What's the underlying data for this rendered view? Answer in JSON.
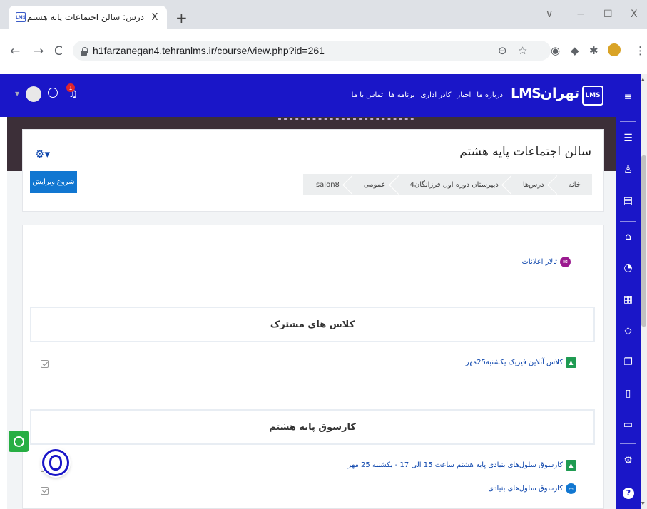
{
  "browser": {
    "tab_title": "درس: سالن اجتماعات پایه هشتم",
    "tab_favicon": "LMS",
    "tab_close": "X",
    "new_tab": "+",
    "url": "h1farzanegan4.tehranlms.ir/course/view.php?id=261",
    "window_controls": {
      "dropdown": "∨",
      "minimize": "−",
      "maximize": "☐",
      "close": "X"
    }
  },
  "navbar": {
    "logo_box": "LMS",
    "logo_text": "LMSتهران",
    "links": [
      "درباره ما",
      "اخبار",
      "کادر اداری",
      "برنامه ها",
      "تماس با ما"
    ],
    "notification_count": "1",
    "accent_color": "#1a16c8"
  },
  "header": {
    "title": "سالن اجتماعات پایه هشتم",
    "breadcrumbs": [
      "خانه",
      "درس‌ها",
      "دبیرستان دوره اول فرزانگان4",
      "عمومی",
      "salon8"
    ],
    "edit_button": "شروع ویرایش"
  },
  "content": {
    "forum_link": "تالار اعلانات",
    "sections": [
      {
        "title": "کلاس های مشترک",
        "activities": [
          {
            "label": "کلاس آنلاین فیزیک یکشنبه25مهر",
            "icon": "bbb-icon"
          }
        ]
      },
      {
        "title": "کارسوق پایه هشتم",
        "activities": [
          {
            "label": "کارسوق سلول‌های بنیادی پایه هشتم ساعت 15 الی 17 - یکشنبه 25 مهر",
            "icon": "bbb-icon"
          },
          {
            "label": "کارسوق سلول‌های بنیادی",
            "icon": "folder-icon"
          }
        ]
      }
    ]
  },
  "sidebar_icons": [
    "menu-icon",
    "list-icon",
    "bookmark-icon",
    "book-icon",
    "home-icon",
    "dashboard-icon",
    "calendar-icon",
    "badge-icon",
    "files-icon",
    "clipboard-icon",
    "folder-icon",
    "settings-icon",
    "help-icon"
  ],
  "help_label": "?"
}
